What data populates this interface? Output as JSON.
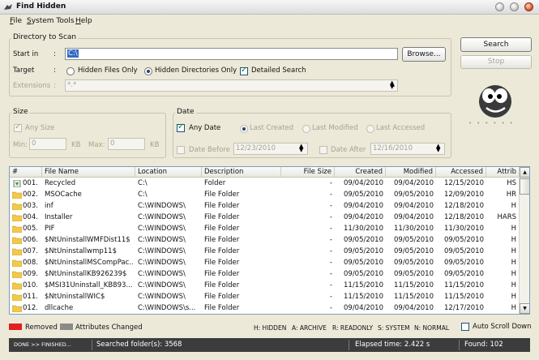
{
  "window": {
    "title": "Find Hidden"
  },
  "menu": [
    {
      "label": "File",
      "key": "F",
      "rest": "ile"
    },
    {
      "label": "System Tools",
      "key": "S",
      "rest": "ystem Tools"
    },
    {
      "label": "Help",
      "key": "H",
      "rest": "elp"
    }
  ],
  "scan": {
    "legend": "Directory to Scan",
    "start_label": "Start in",
    "colon": ":",
    "start_value": "C:\\",
    "browse_label": "Browse...",
    "target_label": "Target",
    "target_options": [
      {
        "label": "Hidden Files Only",
        "selected": false
      },
      {
        "label": "Hidden Directories Only",
        "selected": true
      }
    ],
    "detailed_label": "Detailed Search",
    "detailed_checked": true,
    "extensions_label": "Extensions",
    "extensions_value": "*.*"
  },
  "actions": {
    "search_label": "Search",
    "stop_label": "Stop"
  },
  "size": {
    "legend": "Size",
    "any_label": "Any Size",
    "min_label": "Min:",
    "min_value": "0",
    "max_label": "Max:",
    "max_value": "0",
    "unit": "KB"
  },
  "date": {
    "legend": "Date",
    "any_label": "Any Date",
    "options": [
      "Last Created",
      "Last Modified",
      "Last Accessed"
    ],
    "before_label": "Date Before",
    "before_value": "12/23/2010",
    "after_label": "Date After",
    "after_value": "12/16/2010"
  },
  "table": {
    "columns": [
      "#",
      "File Name",
      "Location",
      "Description",
      "File Size",
      "Created",
      "Modified",
      "Accessed",
      "Attrib"
    ],
    "rows": [
      [
        "001.",
        "Recycled",
        "C:\\",
        "Folder",
        "-",
        "09/04/2010",
        "09/04/2010",
        "12/15/2010",
        "HS"
      ],
      [
        "002.",
        "MSOCache",
        "C:\\",
        "File Folder",
        "-",
        "09/05/2010",
        "09/05/2010",
        "12/09/2010",
        "HR"
      ],
      [
        "003.",
        "inf",
        "C:\\WINDOWS\\",
        "File Folder",
        "-",
        "09/04/2010",
        "09/04/2010",
        "12/18/2010",
        "H"
      ],
      [
        "004.",
        "Installer",
        "C:\\WINDOWS\\",
        "File Folder",
        "-",
        "09/04/2010",
        "09/04/2010",
        "12/18/2010",
        "HARS"
      ],
      [
        "005.",
        "PIF",
        "C:\\WINDOWS\\",
        "File Folder",
        "-",
        "11/30/2010",
        "11/30/2010",
        "11/30/2010",
        "H"
      ],
      [
        "006.",
        "$NtUninstallWMFDist11$",
        "C:\\WINDOWS\\",
        "File Folder",
        "-",
        "09/05/2010",
        "09/05/2010",
        "09/05/2010",
        "H"
      ],
      [
        "007.",
        "$NtUninstallwmp11$",
        "C:\\WINDOWS\\",
        "File Folder",
        "-",
        "09/05/2010",
        "09/05/2010",
        "09/05/2010",
        "H"
      ],
      [
        "008.",
        "$NtUninstallMSCompPac...",
        "C:\\WINDOWS\\",
        "File Folder",
        "-",
        "09/05/2010",
        "09/05/2010",
        "09/05/2010",
        "H"
      ],
      [
        "009.",
        "$NtUninstallKB926239$",
        "C:\\WINDOWS\\",
        "File Folder",
        "-",
        "09/05/2010",
        "09/05/2010",
        "09/05/2010",
        "H"
      ],
      [
        "010.",
        "$MSI31Uninstall_KB893...",
        "C:\\WINDOWS\\",
        "File Folder",
        "-",
        "11/15/2010",
        "11/15/2010",
        "11/15/2010",
        "H"
      ],
      [
        "011.",
        "$NtUninstallWIC$",
        "C:\\WINDOWS\\",
        "File Folder",
        "-",
        "11/15/2010",
        "11/15/2010",
        "11/15/2010",
        "H"
      ],
      [
        "012.",
        "dllcache",
        "C:\\WINDOWS\\s...",
        "File Folder",
        "-",
        "09/04/2010",
        "09/04/2010",
        "12/17/2010",
        "H"
      ]
    ]
  },
  "legend_bar": {
    "removed_label": "Removed",
    "removed_color": "#e02020",
    "changed_label": "Attributes Changed",
    "changed_color": "#8a8a8a",
    "codes": [
      "H: HIDDEN",
      "A: ARCHIVE",
      "R: READONLY",
      "S: SYSTEM",
      "N: NORMAL"
    ],
    "autoscroll_label": "Auto Scroll Down"
  },
  "status": {
    "state": "DONE >> FINISHED...",
    "searched": "Searched folder(s): 3568",
    "elapsed": "Elapsed time:  2.422 s",
    "found": "Found: 102"
  },
  "colors": {
    "selection": "#316ac5",
    "folder": "#f2c94c",
    "status_bg": "#3c3c3c"
  }
}
